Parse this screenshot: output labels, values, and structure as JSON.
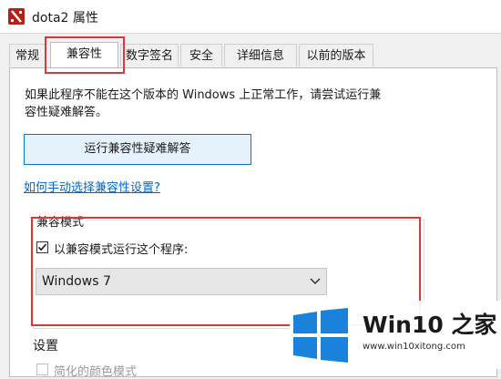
{
  "window": {
    "title": "dota2 属性",
    "icon": "dota2-icon"
  },
  "tabs": [
    {
      "label": "常规"
    },
    {
      "label": "兼容性",
      "active": true
    },
    {
      "label": "数字签名"
    },
    {
      "label": "安全"
    },
    {
      "label": "详细信息"
    },
    {
      "label": "以前的版本"
    }
  ],
  "compat": {
    "description_line1": "如果此程序不能在这个版本的 Windows 上正常工作，请尝试运行兼",
    "description_line2": "容性疑难解答。",
    "run_troubleshooter": "运行兼容性疑难解答",
    "manual_link": "如何手动选择兼容性设置?",
    "mode_group_label": "兼容模式",
    "checkbox_label": "以兼容模式运行这个程序:",
    "checkbox_checked": true,
    "os_select_value": "Windows 7"
  },
  "settings": {
    "label": "设置",
    "first_option_partial": "简化的颜色模式"
  },
  "watermark": {
    "logo": "windows-logo",
    "title": "Win10 之家",
    "url": "www.win10xitong.com"
  },
  "colors": {
    "accent_link": "#0066cc",
    "highlight_red": "#d63b3b",
    "windows_blue": "#1a82d8"
  }
}
